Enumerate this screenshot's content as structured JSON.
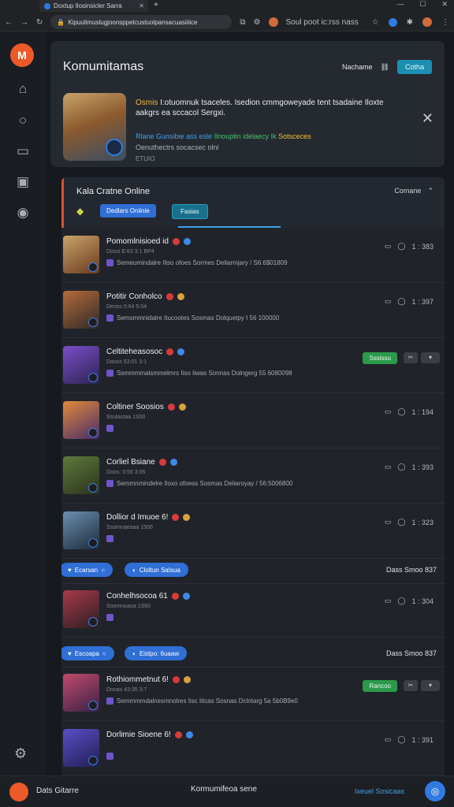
{
  "browser": {
    "tab_title": "Doxtup Ilosinsicler Sarra",
    "new_tab": "+",
    "url": "Kipuulimuslugjoonsppetcustuolpansacuasiiiice",
    "ext_label": "Soul poot ic:rss nass",
    "window_min": "—",
    "window_max": "☐",
    "window_close": "✕"
  },
  "header": {
    "title": "Komumitamas",
    "right_label": "Nachame",
    "button": "Cotha"
  },
  "promo": {
    "highlight": "Osmis",
    "text": "I:otuomnuk tsaceles. Isedion cmmgoweyade tent tsadaine Iloxte aakgrs ea sccacol Sergxi.",
    "link_blue": "Rlane Gunsibie ass esle",
    "link_green": "Ilnouptin idelaecy Ik",
    "link_yellow": "Sotsceces",
    "sub": "Oenuthectrs socacsec olni",
    "meta": "ETUIO"
  },
  "list": {
    "title": "Kala Cratne Online",
    "right": "Comane",
    "chip_blue": "Dedlars Oniinie",
    "chip_teal": "Fasias",
    "rows": [
      {
        "title": "Pomomlnisioed id",
        "sub": "Dossi E:63 3:1 BP4",
        "desc": "Semeumindalre Iliso ofoes Sormes Deliarmjary / S6.6$01809",
        "meta": "1 : 383",
        "thumb_a": "#c9a36a",
        "thumb_b": "#6b3a1e"
      },
      {
        "title": "Potitir Conholco",
        "sub": "Deoss 0:64 5:04",
        "desc": "Semsmmnidalre Itucootes Sosmas Dolquetpy I 56 100000",
        "meta": "1 : 397",
        "thumb_a": "#b56b3a",
        "thumb_b": "#2f2a28"
      },
      {
        "title": "Celtiteheasosoc",
        "sub": "Daoss 53:01 3:1",
        "desc": "Ssmmmmalsmmelmrs Iiso Iiwas Sonnas Dolngerg 55 6080098",
        "meta": "",
        "green": "Sssissu",
        "thumb_a": "#7a4ec6",
        "thumb_b": "#2c2454"
      },
      {
        "title": "Coltiner Soosios",
        "sub": "Ssutastaa 1S00",
        "desc": "",
        "meta": "1 : 194",
        "thumb_a": "#e08a3a",
        "thumb_b": "#4a2c6a"
      },
      {
        "title": "Corliel Bsiane",
        "sub": "Doos: 0:56 3:06",
        "desc": "Semmnmindelre Iloxo ofoess Sosmas Deliaroyay / 56:5006800",
        "meta": "1 : 393",
        "thumb_a": "#5e7a3a",
        "thumb_b": "#2a331e"
      },
      {
        "title": "Dollior d Imuoe 6!",
        "sub": "Ssomnaeaaa 1500",
        "desc": "",
        "meta": "1 : 323",
        "thumb_a": "#6a8fb0",
        "thumb_b": "#1e2b3a"
      },
      {
        "title": "Conhelhsocoa 61",
        "sub": "Soomnoaoa 1S60",
        "desc": "",
        "meta": "1 : 304",
        "thumb_a": "#a83a4a",
        "thumb_b": "#2a1e24"
      },
      {
        "title": "Rothiommetnut 6!",
        "sub": "Dooas 43:35 3:7",
        "desc": "Semmmmdalnesmnolres Iisc Iitcas Sosnas Dclntarg 5a 5b0B9e0",
        "meta": "",
        "green": "Rancoo",
        "thumb_a": "#c04a6a",
        "thumb_b": "#3a2248"
      },
      {
        "title": "Dorlimie Sioene 6!",
        "sub": "",
        "desc": "",
        "meta": "1 : 391",
        "thumb_a": "#5a4ec6",
        "thumb_b": "#1f2054"
      }
    ],
    "pills": [
      {
        "a": "Ecarsan",
        "b": "Cloltun SaIsua",
        "right": "Dass Smoo 837"
      },
      {
        "a": "Escoapa",
        "b": "Eistpo: 6uaaw",
        "right": "Dass Smoo 837"
      }
    ]
  },
  "bottom": {
    "left": "Dats Gitarre",
    "mid": "Kormumifeoa sene",
    "right": "Ixeuel Sosicaas"
  }
}
